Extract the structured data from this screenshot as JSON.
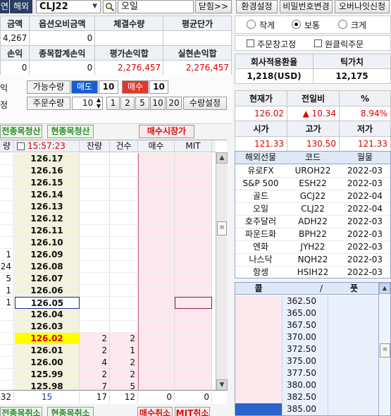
{
  "header": {
    "tab_partial": "연",
    "tab_overseas": "해외",
    "code": "CLJ22",
    "name": "오일",
    "close_label": "닫힘>>"
  },
  "summary": {
    "row1_headers": [
      "금액",
      "옵션오비금액",
      "체결수량",
      "평균단가"
    ],
    "row1_values": [
      "4,267",
      "0",
      "",
      ""
    ],
    "row2_headers": [
      "손익",
      "종목합계손익",
      "평가손익합",
      "실현손익합"
    ],
    "row2_values": [
      "0",
      "0",
      "2,276,457",
      "2,276,457"
    ]
  },
  "order": {
    "side_labels": [
      "익",
      "정"
    ],
    "available_label": "가능수량",
    "sell_label": "매도",
    "sell_qty": "10",
    "buy_label": "매수",
    "buy_qty": "10",
    "order_qty_label": "주문수량",
    "order_qty_value": "10",
    "qty_presets": [
      "1",
      "2",
      "5",
      "10",
      "20"
    ],
    "qty_settings_label": "수량설정"
  },
  "actions": {
    "settle_all_label": "전종목청산",
    "settle_current_label": "현종목청산",
    "market_buy_label": "매수시장가"
  },
  "ladder": {
    "headers": [
      "량",
      "15:57:23",
      "잔량",
      "건수",
      "매수",
      "MIT"
    ],
    "rows": [
      {
        "qty": "",
        "price": "126.17",
        "rem": "",
        "cnt": "",
        "hl": ""
      },
      {
        "qty": "",
        "price": "126.16",
        "rem": "",
        "cnt": "",
        "hl": ""
      },
      {
        "qty": "",
        "price": "126.15",
        "rem": "",
        "cnt": "",
        "hl": ""
      },
      {
        "qty": "",
        "price": "126.14",
        "rem": "",
        "cnt": "",
        "hl": ""
      },
      {
        "qty": "",
        "price": "126.13",
        "rem": "",
        "cnt": "",
        "hl": ""
      },
      {
        "qty": "",
        "price": "126.12",
        "rem": "",
        "cnt": "",
        "hl": ""
      },
      {
        "qty": "",
        "price": "126.11",
        "rem": "",
        "cnt": "",
        "hl": ""
      },
      {
        "qty": "",
        "price": "126.10",
        "rem": "",
        "cnt": "",
        "hl": ""
      },
      {
        "qty": "1",
        "price": "126.09",
        "rem": "",
        "cnt": "",
        "hl": ""
      },
      {
        "qty": "24",
        "price": "126.08",
        "rem": "",
        "cnt": "",
        "hl": ""
      },
      {
        "qty": "5",
        "price": "126.07",
        "rem": "",
        "cnt": "",
        "hl": ""
      },
      {
        "qty": "1",
        "price": "126.06",
        "rem": "",
        "cnt": "",
        "hl": ""
      },
      {
        "qty": "1",
        "price": "126.05",
        "rem": "",
        "cnt": "",
        "hl": "box"
      },
      {
        "qty": "",
        "price": "126.04",
        "rem": "",
        "cnt": "",
        "hl": ""
      },
      {
        "qty": "",
        "price": "126.03",
        "rem": "",
        "cnt": "",
        "hl": ""
      },
      {
        "qty": "",
        "price": "126.02",
        "rem": "2",
        "cnt": "2",
        "hl": "cur"
      },
      {
        "qty": "",
        "price": "126.01",
        "rem": "2",
        "cnt": "1",
        "hl": ""
      },
      {
        "qty": "",
        "price": "126.00",
        "rem": "4",
        "cnt": "2",
        "hl": ""
      },
      {
        "qty": "",
        "price": "125.99",
        "rem": "2",
        "cnt": "2",
        "hl": ""
      },
      {
        "qty": "",
        "price": "125.98",
        "rem": "7",
        "cnt": "5",
        "hl": ""
      }
    ],
    "footer": [
      "32",
      "15",
      "17",
      "12",
      "0",
      "0"
    ]
  },
  "bottom": {
    "labels": [
      "전종목취소",
      "현종목취소",
      "매수취소",
      "MIT취소"
    ]
  },
  "right": {
    "top_buttons": [
      "환경설정",
      "비밀번호변경",
      "오버나잇신청"
    ],
    "sizes": [
      {
        "label": "작게",
        "on": false
      },
      {
        "label": "보통",
        "on": true
      },
      {
        "label": "크게",
        "on": false
      }
    ],
    "fix_order_label": "주문창고정",
    "one_click_label": "원클릭주문",
    "rate_header": "회사적용환율",
    "tick_header": "틱가치",
    "rate_value": "1,218(USD)",
    "tick_value": "12,175",
    "quote_headers1": [
      "현재가",
      "전일비",
      "%"
    ],
    "quote_values1": [
      "126.02",
      "▲ 10.34",
      "8.94%"
    ],
    "quote_headers2": [
      "시가",
      "고가",
      "저가"
    ],
    "quote_values2": [
      "121.33",
      "130.50",
      "121.33"
    ],
    "futures_headers": [
      "해외선물",
      "코드",
      "월물"
    ],
    "futures": [
      {
        "name": "유로FX",
        "code": "UROH22",
        "month": "2022-03"
      },
      {
        "name": "S&P 500",
        "code": "ESH22",
        "month": "2022-03"
      },
      {
        "name": "골드",
        "code": "GCJ22",
        "month": "2022-04"
      },
      {
        "name": "오일",
        "code": "CLJ22",
        "month": "2022-04"
      },
      {
        "name": "호주달러",
        "code": "ADH22",
        "month": "2022-03"
      },
      {
        "name": "파운드화",
        "code": "BPH22",
        "month": "2022-03"
      },
      {
        "name": "엔화",
        "code": "JYH22",
        "month": "2022-03"
      },
      {
        "name": "나스닥",
        "code": "NQH22",
        "month": "2022-03"
      },
      {
        "name": "항셍",
        "code": "HSIH22",
        "month": "2022-03"
      }
    ],
    "option_headers": [
      "콜",
      "/",
      "풋"
    ],
    "options": [
      "362.50",
      "365.00",
      "367.50",
      "370.00",
      "372.50",
      "375.00",
      "377.50",
      "380.00",
      "382.50",
      "385.00"
    ]
  }
}
